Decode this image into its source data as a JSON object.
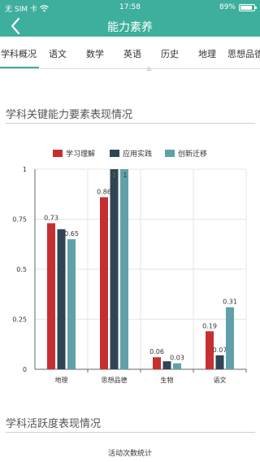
{
  "status_bar": {
    "carrier": "无 SIM 卡",
    "wifi_icon": "wifi-icon",
    "time": "17:58",
    "battery_percent": "89%",
    "battery_level": 0.89
  },
  "nav": {
    "back_icon": "chevron-left-icon",
    "title": "能力素养"
  },
  "tabs": [
    {
      "label": "学科概况"
    },
    {
      "label": "语文"
    },
    {
      "label": "数学"
    },
    {
      "label": "英语"
    },
    {
      "label": "历史"
    },
    {
      "label": "地理"
    },
    {
      "label": "思想品德"
    }
  ],
  "active_tab_index": 0,
  "section1": {
    "title": "学科关键能力要素表现情况"
  },
  "section2": {
    "title": "学科活跃度表现情况",
    "subtitle": "活动次数统计"
  },
  "colors": {
    "accent": "#3eaf9c",
    "series": [
      "#c62f30",
      "#2f4554",
      "#61a0a8"
    ]
  },
  "chart_data": {
    "type": "bar",
    "categories": [
      "地理",
      "思想品德",
      "生物",
      "语文"
    ],
    "series": [
      {
        "name": "学习理解",
        "values": [
          0.73,
          0.86,
          0.06,
          0.19
        ]
      },
      {
        "name": "应用实践",
        "values": [
          0.7,
          1,
          0.04,
          0.07
        ]
      },
      {
        "name": "创新迁移",
        "values": [
          0.65,
          1,
          0.03,
          0.31
        ]
      }
    ],
    "data_labels": [
      [
        "0.73",
        "0.86",
        "0.06",
        "0.19"
      ],
      [
        "",
        "1",
        "",
        "0.07"
      ],
      [
        "0.65",
        "1",
        "0.03",
        "0.31"
      ]
    ],
    "ylim": [
      0,
      1
    ],
    "yticks": [
      "0",
      "0.25",
      "0.5",
      "0.75",
      "1"
    ],
    "grid": true,
    "legend": "top"
  }
}
